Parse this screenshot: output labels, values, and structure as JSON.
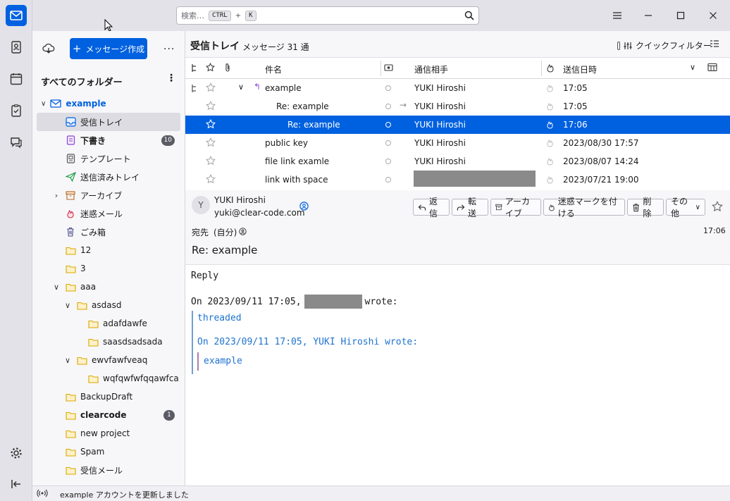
{
  "app": {
    "accent": "#0061e0"
  },
  "search": {
    "placeholder": "検索…",
    "kbd1": "CTRL",
    "plus": "+",
    "kbd2": "K"
  },
  "folderpane": {
    "compose_label": "メッセージ作成",
    "header": "すべてのフォルダー",
    "account": "example",
    "folders": [
      {
        "label": "受信トレイ",
        "icon": "inbox-icon"
      },
      {
        "label": "下書き",
        "icon": "drafts-icon",
        "badge": "10"
      },
      {
        "label": "テンプレート",
        "icon": "templates-icon"
      },
      {
        "label": "送信済みトレイ",
        "icon": "sent-icon"
      },
      {
        "label": "アーカイブ",
        "icon": "archive-icon"
      },
      {
        "label": "迷惑メール",
        "icon": "junk-icon"
      },
      {
        "label": "ごみ箱",
        "icon": "trash-icon"
      },
      {
        "label": "12",
        "icon": "folder-icon"
      },
      {
        "label": "3",
        "icon": "folder-icon"
      },
      {
        "label": "aaa",
        "icon": "folder-icon"
      },
      {
        "label": "asdasd",
        "icon": "folder-icon"
      },
      {
        "label": "adafdawfe",
        "icon": "folder-icon"
      },
      {
        "label": "saasdsadsada",
        "icon": "folder-icon"
      },
      {
        "label": "ewvfawfveaq",
        "icon": "folder-icon"
      },
      {
        "label": "wqfqwfwfqqawfca",
        "icon": "folder-icon"
      },
      {
        "label": "BackupDraft",
        "icon": "folder-icon"
      },
      {
        "label": "clearcode",
        "icon": "folder-icon",
        "badge": "1"
      },
      {
        "label": "new project",
        "icon": "folder-icon"
      },
      {
        "label": "Spam",
        "icon": "folder-icon"
      },
      {
        "label": "受信メール",
        "icon": "folder-icon"
      }
    ]
  },
  "list": {
    "title": "受信トレイ",
    "count": "メッセージ 31 通",
    "quickfilter": "クイックフィルター",
    "columns": {
      "subject": "件名",
      "correspondent": "通信相手",
      "date": "送信日時"
    },
    "rows": [
      {
        "subject": "example",
        "from": "YUKI Hiroshi",
        "date": "17:05"
      },
      {
        "subject": "Re: example",
        "from": "YUKI Hiroshi",
        "date": "17:05"
      },
      {
        "subject": "Re: example",
        "from": "YUKI Hiroshi",
        "date": "17:06"
      },
      {
        "subject": "public key",
        "from": "YUKI Hiroshi",
        "date": "2023/08/30 17:57"
      },
      {
        "subject": "file link examle",
        "from": "YUKI Hiroshi",
        "date": "2023/08/07 14:24"
      },
      {
        "subject": "link with space",
        "from": "",
        "date": "2023/07/21 19:00"
      }
    ]
  },
  "message": {
    "avatar": "Y",
    "from_name": "YUKI Hiroshi",
    "from_email": "yuki@clear-code.com",
    "buttons": {
      "reply": "返信",
      "forward": "転送",
      "archive": "アーカイブ",
      "junk": "迷惑マークを付ける",
      "delete": "削除",
      "more": "その他"
    },
    "to_label": "宛先",
    "to_value": "(自分)",
    "time": "17:06",
    "subject": "Re: example",
    "body": {
      "line1": "Reply",
      "attr_prefix": "On 2023/09/11 17:05,",
      "attr_suffix": "wrote:",
      "quote1": "threaded",
      "quote_attr": "On 2023/09/11 17:05, YUKI Hiroshi wrote:",
      "quote2": "example"
    }
  },
  "status": {
    "text": "example アカウントを更新しました"
  }
}
